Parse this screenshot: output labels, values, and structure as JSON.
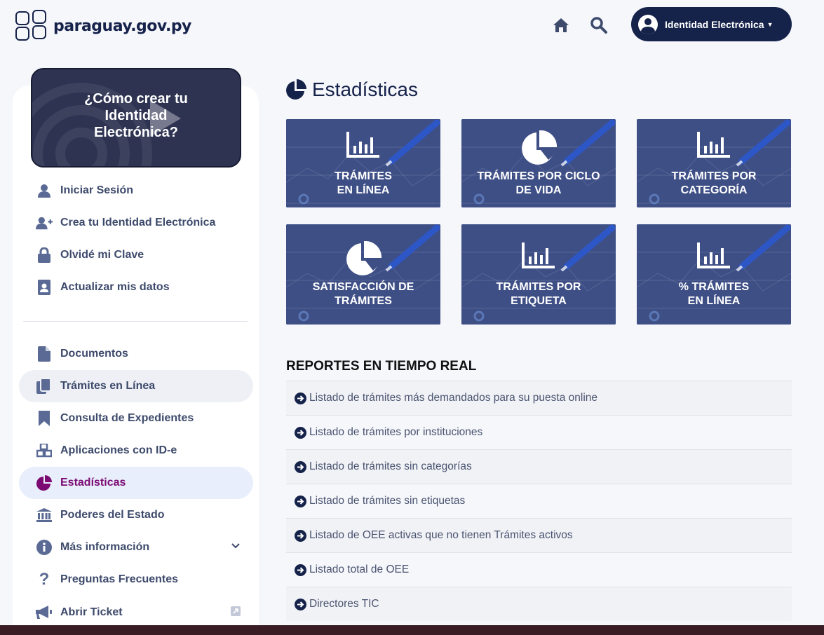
{
  "header": {
    "site_name": "paraguay.gov.py",
    "account_button": "Identidad Electrónica",
    "icons": [
      "home-icon",
      "search-icon",
      "user-circle-icon"
    ]
  },
  "sidebar": {
    "video_card_title": "¿Cómo crear tu Identidad Electrónica?",
    "account_items": [
      {
        "label": "Iniciar Sesión",
        "icon": "user-icon"
      },
      {
        "label": "Crea tu Identidad Electrónica",
        "icon": "user-plus-icon"
      },
      {
        "label": "Olvidé mi Clave",
        "icon": "lock-icon"
      },
      {
        "label": "Actualizar mis datos",
        "icon": "contact-card-icon"
      }
    ],
    "nav_items": [
      {
        "label": "Documentos",
        "icon": "document-icon"
      },
      {
        "label": "Trámites en Línea",
        "icon": "copy-documents-icon"
      },
      {
        "label": "Consulta de Expedientes",
        "icon": "bookmark-icon"
      },
      {
        "label": "Aplicaciones con ID-e",
        "icon": "cubes-icon"
      },
      {
        "label": "Estadísticas",
        "icon": "pie-chart-icon",
        "active": true
      },
      {
        "label": "Poderes del Estado",
        "icon": "institution-icon"
      },
      {
        "label": "Más información",
        "icon": "info-icon"
      },
      {
        "label": "Preguntas Frecuentes",
        "icon": "question-icon"
      },
      {
        "label": "Abrir Ticket",
        "icon": "megaphone-icon"
      }
    ]
  },
  "main": {
    "title": "Estadísticas",
    "tiles": [
      {
        "line1": "TRÁMITES",
        "line2": "EN LÍNEA",
        "icon": "bar-chart-icon"
      },
      {
        "line1": "TRÁMITES POR CICLO",
        "line2": "DE VIDA",
        "icon": "pie-chart-icon"
      },
      {
        "line1": "TRÁMITES POR",
        "line2": "CATEGORÍA",
        "icon": "bar-chart-icon"
      },
      {
        "line1": "SATISFACCIÓN DE",
        "line2": "TRÁMITES",
        "icon": "pie-chart-icon"
      },
      {
        "line1": "TRÁMITES POR",
        "line2": "ETIQUETA",
        "icon": "bar-chart-icon"
      },
      {
        "line1": "% TRÁMITES",
        "line2": "EN LÍNEA",
        "icon": "bar-chart-icon"
      }
    ],
    "reports_title": "REPORTES EN TIEMPO REAL",
    "reports": [
      "Listado de trámites más demandados para su puesta online",
      "Listado de trámites por instituciones",
      "Listado de trámites sin categorías",
      "Listado de trámites sin etiquetas",
      "Listado de OEE activas que no tienen Trámites activos",
      "Listado total de OEE",
      "Directores TIC"
    ]
  },
  "colors": {
    "brand_navy": "#15224a",
    "active_purple": "#7b0a73",
    "tile_blue": "#3e4f86"
  }
}
